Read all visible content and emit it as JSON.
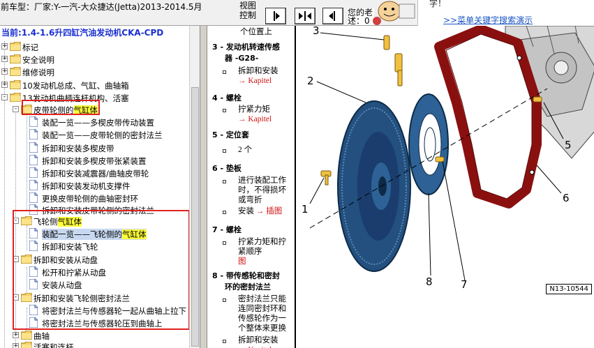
{
  "topbar": {
    "vehicle": "前车型：厂家:Y-一汽-大众捷达(Jetta)2013-2014.5月",
    "view_control": "视图控制",
    "hint_text": "您的老",
    "hint_text2": "述：0",
    "search_tip": "字！",
    "search_demo": ">>菜单关键字搜索演示"
  },
  "tree": {
    "header": "当前:1.4-1.6升四缸汽油发动机CKA-CPD",
    "items": [
      {
        "label": "标记"
      },
      {
        "label": "安全说明"
      },
      {
        "label": "维修说明"
      },
      {
        "label": "10发动机总成、气缸、曲轴箱"
      },
      {
        "label": "13发动机曲柄连杆机构、活塞"
      },
      {
        "label_pre": "皮带轮侧的",
        "label_hl": "气缸体"
      },
      {
        "label": "装配一览——多楔皮带传动装置"
      },
      {
        "label": "装配一览——皮带轮侧的密封法兰"
      },
      {
        "label": "拆卸和安装多楔皮带"
      },
      {
        "label": "拆卸和安装多楔皮带张紧装置"
      },
      {
        "label": "拆卸和安装减震器/曲轴皮带轮"
      },
      {
        "label": "拆卸和安装发动机支撑件"
      },
      {
        "label": "更换皮带轮侧的曲轴密封环"
      },
      {
        "label": "拆卸和安装皮带轮侧的密封法兰"
      },
      {
        "label_pre": "飞轮侧",
        "label_hl": "气缸体"
      },
      {
        "label_pre": "装配一览——飞轮侧的",
        "label_hl": "气缸体"
      },
      {
        "label": "拆卸和安装飞轮"
      },
      {
        "label": "拆卸和安装从动盘"
      },
      {
        "label": "松开和拧紧从动盘"
      },
      {
        "label": "安装从动盘"
      },
      {
        "label": "拆卸和安装飞轮侧密封法兰"
      },
      {
        "label": "将密封法兰与传感器轮一起从曲轴上拉下"
      },
      {
        "label": "将密封法兰与传感器轮压到曲轴上"
      },
      {
        "label": "曲轴"
      },
      {
        "label": "活塞和连杆"
      }
    ]
  },
  "legend": {
    "top_line": "个位置上",
    "items": [
      {
        "title": "3 - 发动机转速传感",
        "title2": "器 -G28-"
      },
      {
        "bullet": "拆卸和安装",
        "link": "→ Kapitel"
      },
      {
        "title": "4 - 螺栓"
      },
      {
        "bullet": "拧紧力矩",
        "link": "→ Kapitel"
      },
      {
        "title": "5 - 定位套"
      },
      {
        "bullet": "2 个"
      },
      {
        "title": "6 - 垫板"
      },
      {
        "bullet_lines": [
          "进行装配工作",
          "时，不得损坏",
          "或弯折"
        ]
      },
      {
        "bullet": "安装",
        "link": "→ 插图"
      },
      {
        "title": "7 - 螺栓"
      },
      {
        "bullet_lines": [
          "拧紧力矩和拧",
          "紧顺序"
        ],
        "link": "→ 插",
        "link2": "图"
      },
      {
        "title": "8 - 带传感轮和密封",
        "title2": "环的密封法兰"
      },
      {
        "bullet_lines": [
          "密封法兰只能",
          "连同密封环和",
          "传感轮作为一",
          "个整体来更换"
        ]
      },
      {
        "bullet": "拆卸和安装",
        "link": "→ Kapitel"
      }
    ]
  },
  "figure": {
    "callouts": [
      "1",
      "2",
      "3",
      "5",
      "6",
      "7",
      "8"
    ],
    "code": "N13-10544"
  },
  "colors": {
    "tree_header": "#1a2fd0",
    "highlight": "#ffff3a",
    "red_box": "#e02020",
    "link_red": "#d01010",
    "flywheel_blue": "#1a3d6e",
    "gasket_red": "#8a1010",
    "bolt_yellow": "#f0c040"
  }
}
